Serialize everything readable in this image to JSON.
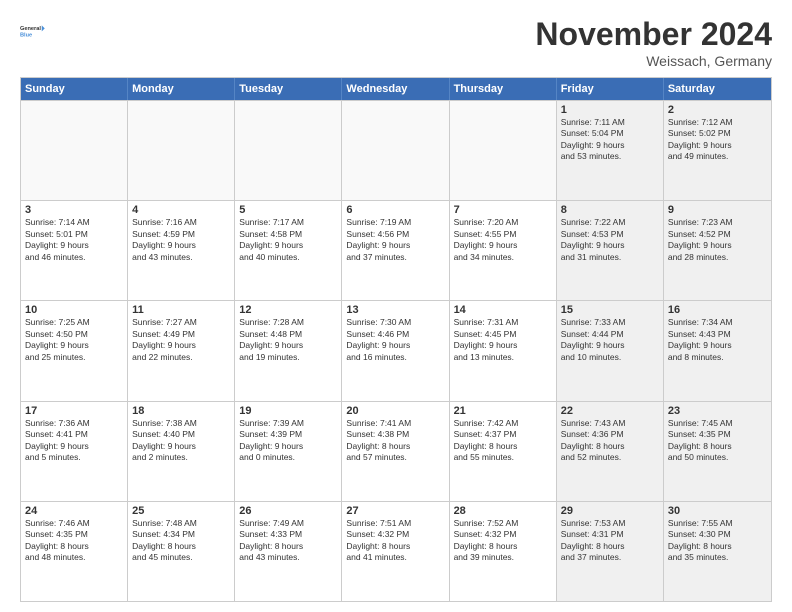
{
  "logo": {
    "line1": "General",
    "line2": "Blue"
  },
  "header": {
    "month": "November 2024",
    "location": "Weissach, Germany"
  },
  "days": [
    "Sunday",
    "Monday",
    "Tuesday",
    "Wednesday",
    "Thursday",
    "Friday",
    "Saturday"
  ],
  "weeks": [
    [
      {
        "day": "",
        "empty": true
      },
      {
        "day": "",
        "empty": true
      },
      {
        "day": "",
        "empty": true
      },
      {
        "day": "",
        "empty": true
      },
      {
        "day": "",
        "empty": true
      },
      {
        "day": "1",
        "shaded": true,
        "lines": [
          "Sunrise: 7:11 AM",
          "Sunset: 5:04 PM",
          "Daylight: 9 hours",
          "and 53 minutes."
        ]
      },
      {
        "day": "2",
        "shaded": true,
        "lines": [
          "Sunrise: 7:12 AM",
          "Sunset: 5:02 PM",
          "Daylight: 9 hours",
          "and 49 minutes."
        ]
      }
    ],
    [
      {
        "day": "3",
        "lines": [
          "Sunrise: 7:14 AM",
          "Sunset: 5:01 PM",
          "Daylight: 9 hours",
          "and 46 minutes."
        ]
      },
      {
        "day": "4",
        "lines": [
          "Sunrise: 7:16 AM",
          "Sunset: 4:59 PM",
          "Daylight: 9 hours",
          "and 43 minutes."
        ]
      },
      {
        "day": "5",
        "lines": [
          "Sunrise: 7:17 AM",
          "Sunset: 4:58 PM",
          "Daylight: 9 hours",
          "and 40 minutes."
        ]
      },
      {
        "day": "6",
        "lines": [
          "Sunrise: 7:19 AM",
          "Sunset: 4:56 PM",
          "Daylight: 9 hours",
          "and 37 minutes."
        ]
      },
      {
        "day": "7",
        "lines": [
          "Sunrise: 7:20 AM",
          "Sunset: 4:55 PM",
          "Daylight: 9 hours",
          "and 34 minutes."
        ]
      },
      {
        "day": "8",
        "shaded": true,
        "lines": [
          "Sunrise: 7:22 AM",
          "Sunset: 4:53 PM",
          "Daylight: 9 hours",
          "and 31 minutes."
        ]
      },
      {
        "day": "9",
        "shaded": true,
        "lines": [
          "Sunrise: 7:23 AM",
          "Sunset: 4:52 PM",
          "Daylight: 9 hours",
          "and 28 minutes."
        ]
      }
    ],
    [
      {
        "day": "10",
        "lines": [
          "Sunrise: 7:25 AM",
          "Sunset: 4:50 PM",
          "Daylight: 9 hours",
          "and 25 minutes."
        ]
      },
      {
        "day": "11",
        "lines": [
          "Sunrise: 7:27 AM",
          "Sunset: 4:49 PM",
          "Daylight: 9 hours",
          "and 22 minutes."
        ]
      },
      {
        "day": "12",
        "lines": [
          "Sunrise: 7:28 AM",
          "Sunset: 4:48 PM",
          "Daylight: 9 hours",
          "and 19 minutes."
        ]
      },
      {
        "day": "13",
        "lines": [
          "Sunrise: 7:30 AM",
          "Sunset: 4:46 PM",
          "Daylight: 9 hours",
          "and 16 minutes."
        ]
      },
      {
        "day": "14",
        "lines": [
          "Sunrise: 7:31 AM",
          "Sunset: 4:45 PM",
          "Daylight: 9 hours",
          "and 13 minutes."
        ]
      },
      {
        "day": "15",
        "shaded": true,
        "lines": [
          "Sunrise: 7:33 AM",
          "Sunset: 4:44 PM",
          "Daylight: 9 hours",
          "and 10 minutes."
        ]
      },
      {
        "day": "16",
        "shaded": true,
        "lines": [
          "Sunrise: 7:34 AM",
          "Sunset: 4:43 PM",
          "Daylight: 9 hours",
          "and 8 minutes."
        ]
      }
    ],
    [
      {
        "day": "17",
        "lines": [
          "Sunrise: 7:36 AM",
          "Sunset: 4:41 PM",
          "Daylight: 9 hours",
          "and 5 minutes."
        ]
      },
      {
        "day": "18",
        "lines": [
          "Sunrise: 7:38 AM",
          "Sunset: 4:40 PM",
          "Daylight: 9 hours",
          "and 2 minutes."
        ]
      },
      {
        "day": "19",
        "lines": [
          "Sunrise: 7:39 AM",
          "Sunset: 4:39 PM",
          "Daylight: 9 hours",
          "and 0 minutes."
        ]
      },
      {
        "day": "20",
        "lines": [
          "Sunrise: 7:41 AM",
          "Sunset: 4:38 PM",
          "Daylight: 8 hours",
          "and 57 minutes."
        ]
      },
      {
        "day": "21",
        "lines": [
          "Sunrise: 7:42 AM",
          "Sunset: 4:37 PM",
          "Daylight: 8 hours",
          "and 55 minutes."
        ]
      },
      {
        "day": "22",
        "shaded": true,
        "lines": [
          "Sunrise: 7:43 AM",
          "Sunset: 4:36 PM",
          "Daylight: 8 hours",
          "and 52 minutes."
        ]
      },
      {
        "day": "23",
        "shaded": true,
        "lines": [
          "Sunrise: 7:45 AM",
          "Sunset: 4:35 PM",
          "Daylight: 8 hours",
          "and 50 minutes."
        ]
      }
    ],
    [
      {
        "day": "24",
        "lines": [
          "Sunrise: 7:46 AM",
          "Sunset: 4:35 PM",
          "Daylight: 8 hours",
          "and 48 minutes."
        ]
      },
      {
        "day": "25",
        "lines": [
          "Sunrise: 7:48 AM",
          "Sunset: 4:34 PM",
          "Daylight: 8 hours",
          "and 45 minutes."
        ]
      },
      {
        "day": "26",
        "lines": [
          "Sunrise: 7:49 AM",
          "Sunset: 4:33 PM",
          "Daylight: 8 hours",
          "and 43 minutes."
        ]
      },
      {
        "day": "27",
        "lines": [
          "Sunrise: 7:51 AM",
          "Sunset: 4:32 PM",
          "Daylight: 8 hours",
          "and 41 minutes."
        ]
      },
      {
        "day": "28",
        "lines": [
          "Sunrise: 7:52 AM",
          "Sunset: 4:32 PM",
          "Daylight: 8 hours",
          "and 39 minutes."
        ]
      },
      {
        "day": "29",
        "shaded": true,
        "lines": [
          "Sunrise: 7:53 AM",
          "Sunset: 4:31 PM",
          "Daylight: 8 hours",
          "and 37 minutes."
        ]
      },
      {
        "day": "30",
        "shaded": true,
        "lines": [
          "Sunrise: 7:55 AM",
          "Sunset: 4:30 PM",
          "Daylight: 8 hours",
          "and 35 minutes."
        ]
      }
    ]
  ]
}
